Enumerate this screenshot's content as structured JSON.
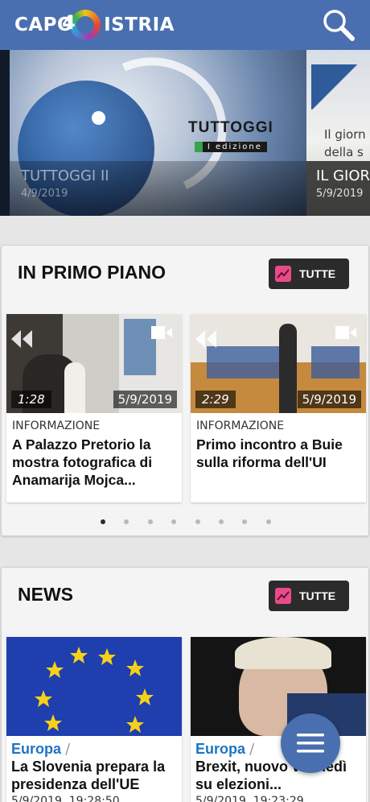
{
  "header": {
    "logo_left": "CAPO",
    "logo_number": "4",
    "logo_right": "ISTRIA",
    "search_icon": "search-icon"
  },
  "hero": {
    "slides": [
      {
        "title": "TUTTOGGI II",
        "date": "4/9/2019",
        "brand": "TUTTOGGI",
        "edition": "I edizione"
      },
      {
        "title": "IL GIOR",
        "date": "5/9/2019",
        "sub1": "Il giorn",
        "sub2": "della s"
      }
    ]
  },
  "primo_piano": {
    "title": "IN PRIMO PIANO",
    "tutte": "TUTTE",
    "cards": [
      {
        "duration": "1:28",
        "date": "5/9/2019",
        "category": "INFORMAZIONE",
        "headline": "A Palazzo Pretorio la mostra fotografica di Anamarija Mojca..."
      },
      {
        "duration": "2:29",
        "date": "5/9/2019",
        "category": "INFORMAZIONE",
        "headline": "Primo incontro a Buie sulla riforma dell'UI"
      }
    ],
    "pager_count": 8,
    "pager_active": 0
  },
  "news": {
    "title": "NEWS",
    "tutte": "TUTTE",
    "cards": [
      {
        "category": "Europa",
        "separator": "/",
        "headline": "La Slovenia prepara la presidenza dell'UE",
        "timestamp": "5/9/2019, 19:28:50"
      },
      {
        "category": "Europa",
        "separator": "/",
        "headline": "Brexit, nuovo v lunedì su elezioni...",
        "timestamp": "5/9/2019, 19:23:29"
      }
    ]
  },
  "colors": {
    "header_bg": "#4a6fb0",
    "category_blue": "#1d74c2",
    "button_dark": "#2b2b2b",
    "icon_pink": "#e94b8a"
  },
  "fab": {
    "icon": "menu-icon"
  }
}
